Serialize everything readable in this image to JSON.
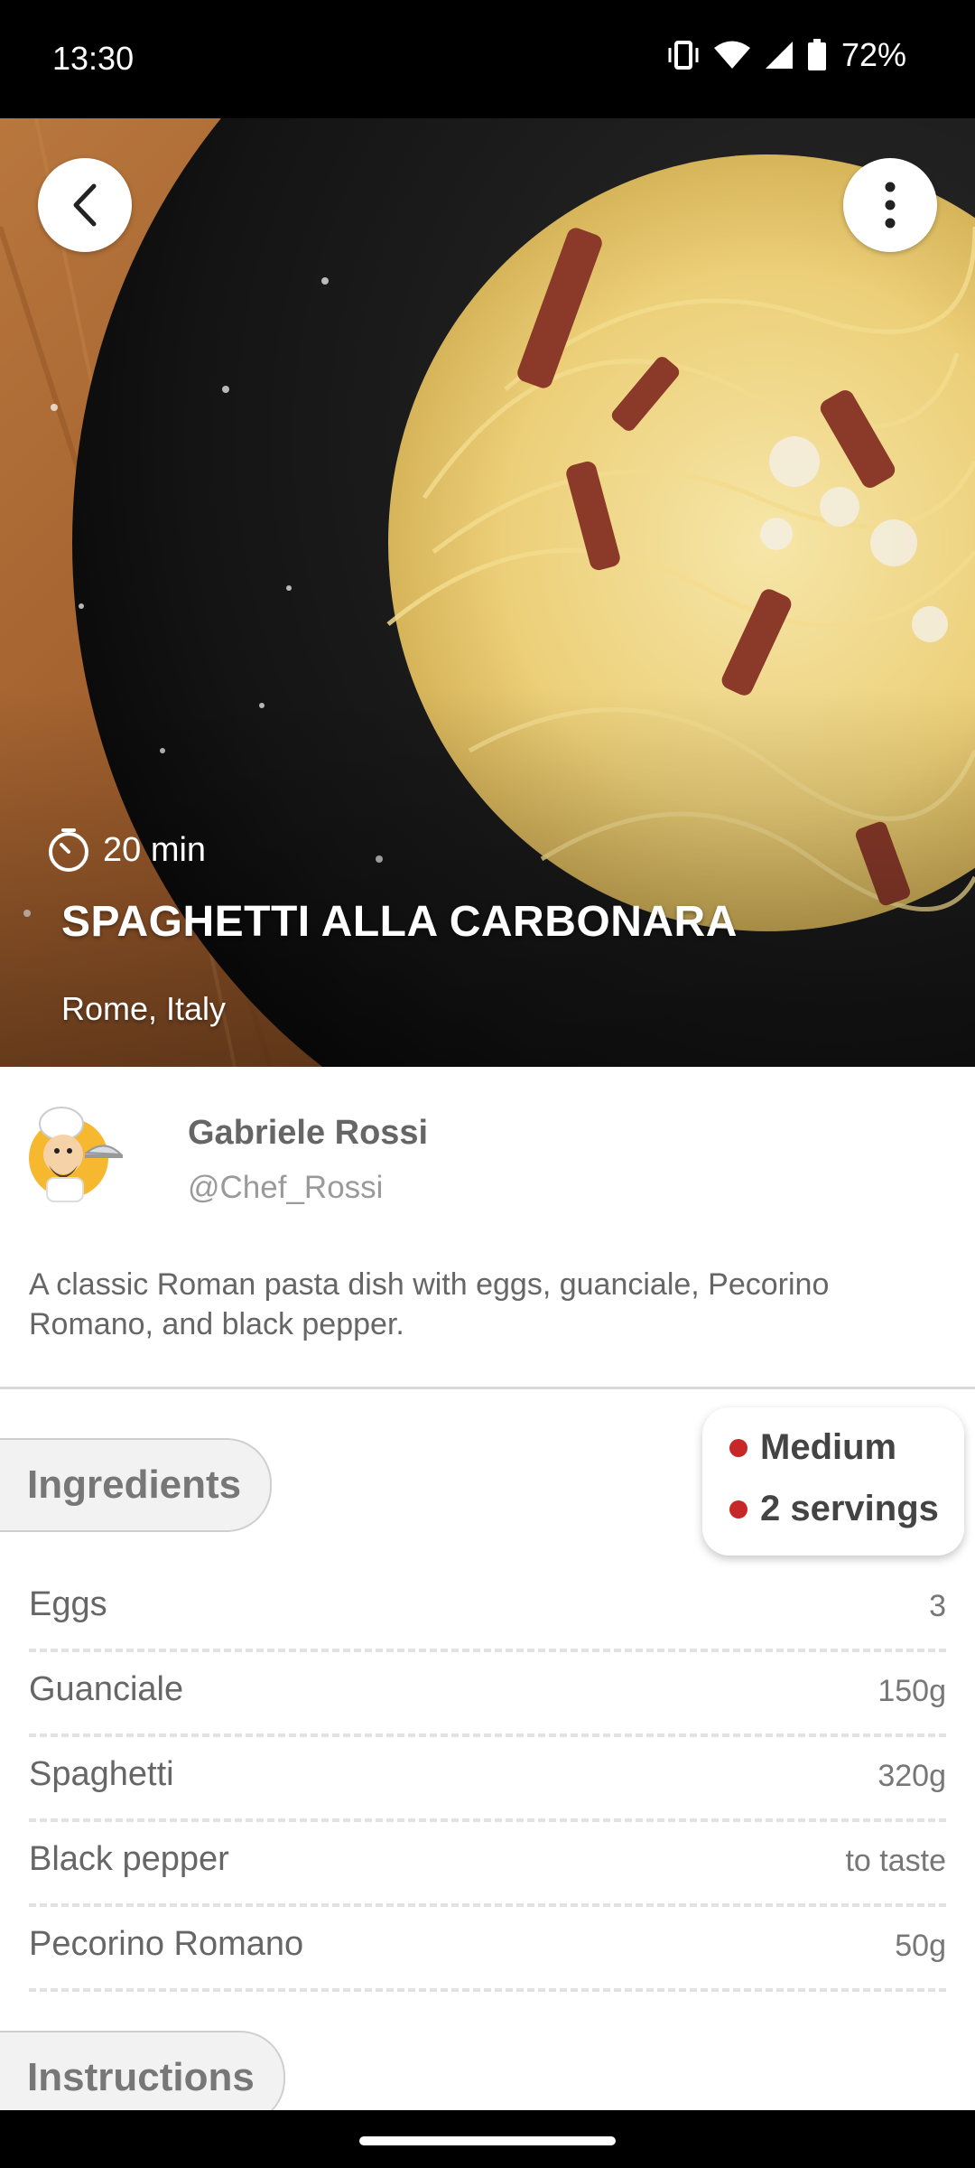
{
  "status_bar": {
    "time": "13:30",
    "battery": "72%",
    "icons": [
      "vibrate-icon",
      "wifi-icon",
      "signal-icon",
      "battery-icon"
    ]
  },
  "hero": {
    "cook_time": "20 min",
    "title": "SPAGHETTI ALLA CARBONARA",
    "location": "Rome, Italy"
  },
  "author": {
    "name": "Gabriele Rossi",
    "handle": "@Chef_Rossi"
  },
  "description": "A classic Roman pasta dish with eggs, guanciale, Pecorino Romano, and black pepper.",
  "badges": {
    "difficulty": "Medium",
    "servings": "2 servings",
    "dot_color": "#c62828"
  },
  "sections": {
    "ingredients": "Ingredients",
    "instructions": "Instructions"
  },
  "ingredients": [
    {
      "name": "Eggs",
      "qty": "3"
    },
    {
      "name": "Guanciale",
      "qty": "150g"
    },
    {
      "name": "Spaghetti",
      "qty": "320g"
    },
    {
      "name": "Black pepper",
      "qty": "to taste"
    },
    {
      "name": "Pecorino Romano",
      "qty": "50g"
    }
  ]
}
